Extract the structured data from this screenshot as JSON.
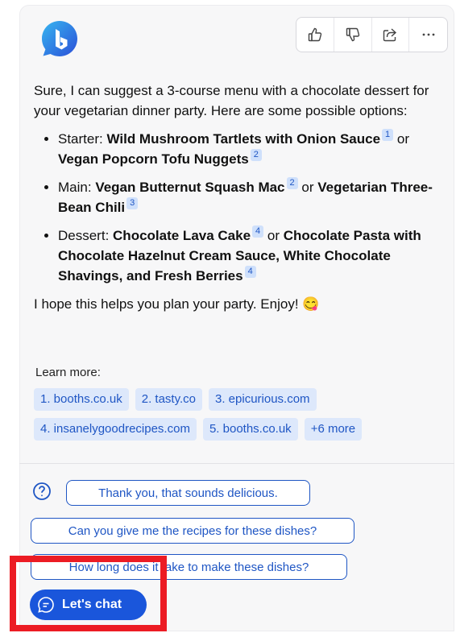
{
  "message": {
    "intro": "Sure, I can suggest a 3-course menu with a chocolate dessert for your vegetarian dinner party. Here are some possible options:",
    "items": [
      {
        "label": "Starter:",
        "dish1": "Wild Mushroom Tartlets with Onion Sauce",
        "cite1": "1",
        "or": "or",
        "dish2": "Vegan Popcorn Tofu Nuggets",
        "cite2": "2"
      },
      {
        "label": "Main:",
        "dish1": "Vegan Butternut Squash Mac",
        "cite1": "2",
        "or": "or",
        "dish2": "Vegetarian Three-Bean Chili",
        "cite2": "3"
      },
      {
        "label": "Dessert:",
        "dish1": "Chocolate Lava Cake",
        "cite1": "4",
        "or": "or",
        "dish2": "Chocolate Pasta with Chocolate Hazelnut Cream Sauce, White Chocolate Shavings, and Fresh Berries",
        "cite2": "4"
      }
    ],
    "closing": "I hope this helps you plan your party. Enjoy! 😋"
  },
  "learn_more": {
    "label": "Learn more:",
    "sources": [
      "1. booths.co.uk",
      "2. tasty.co",
      "3. epicurious.com",
      "4. insanelygoodrecipes.com",
      "5. booths.co.uk",
      "+6 more"
    ]
  },
  "suggestions": [
    "Thank you, that sounds delicious.",
    "Can you give me the recipes for these dishes?",
    "How long does it take to make these dishes?"
  ],
  "lets_chat_label": "Let's chat",
  "icons": {
    "logo": "bing-chat-logo",
    "thumbs_up": "thumbs-up-icon",
    "thumbs_down": "thumbs-down-icon",
    "share": "share-icon",
    "more": "more-icon",
    "help": "question-icon",
    "chat": "chat-bubble-icon"
  },
  "colors": {
    "accent": "#1a56db",
    "chip_bg": "#dde8fb",
    "highlight": "#ec1c24"
  }
}
